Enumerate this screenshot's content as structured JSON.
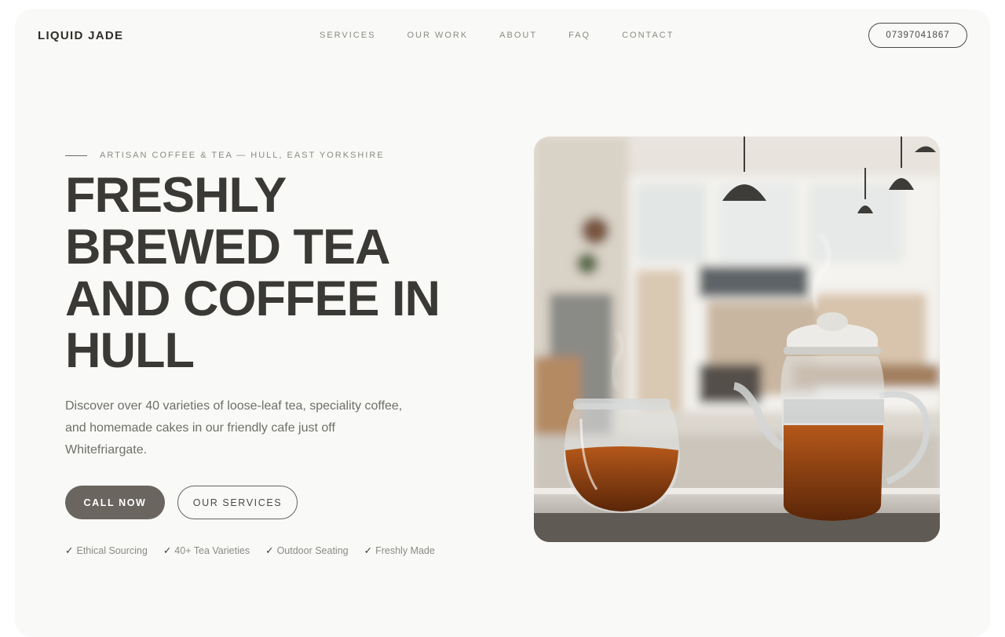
{
  "brand": {
    "name": "LIQUID JADE"
  },
  "nav": {
    "items": [
      "SERVICES",
      "OUR WORK",
      "ABOUT",
      "FAQ",
      "CONTACT"
    ],
    "phone": "07397041867"
  },
  "hero": {
    "eyebrow": "ARTISAN COFFEE & TEA — HULL, EAST YORKSHIRE",
    "headline": [
      "FRESHLY",
      "BREWED TEA",
      "AND COFFEE IN",
      "HULL"
    ],
    "description": "Discover over 40 varieties of loose-leaf tea, speciality coffee, and homemade cakes in our friendly cafe just off Whitefriargate.",
    "primary_cta": "CALL NOW",
    "secondary_cta": "OUR SERVICES",
    "features": [
      "Ethical Sourcing",
      "40+ Tea Varieties",
      "Outdoor Seating",
      "Freshly Made"
    ],
    "check_icon": "✓"
  },
  "colors": {
    "background": "#f9f9f7",
    "text": "#3a3935",
    "muted": "#8b8a85",
    "button": "#6a655f"
  }
}
